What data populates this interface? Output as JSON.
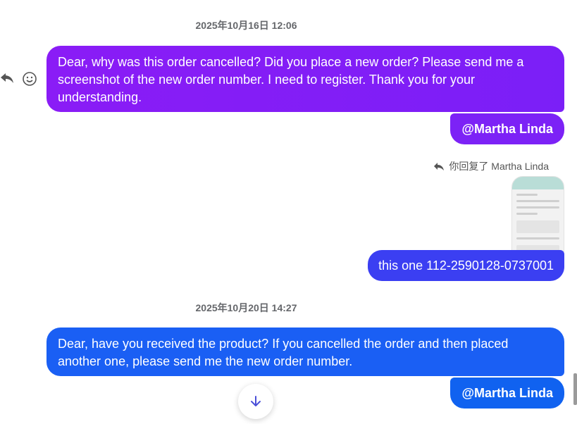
{
  "conversation": {
    "timestamp_1": "2025年10月16日 12:06",
    "message_1": "Dear, why was this order cancelled? Did you place a new order? Please send me a screenshot of the new order number. I need to register. Thank you for your understanding.",
    "mention_1": "@Martha Linda",
    "reply_label": "你回复了 Martha Linda",
    "reply_message": "this one 112-2590128-0737001",
    "timestamp_2": "2025年10月20日 14:27",
    "message_2": "Dear, have you received the product? If you cancelled the order and then placed another one, please send me the new order number.",
    "mention_2": "@Martha Linda"
  },
  "icons": {
    "reply": "reply-icon",
    "emoji": "smile-icon",
    "scroll": "arrow-down-icon"
  },
  "colors": {
    "purple_bubble": "#8a1cf6",
    "blue_bubble": "#3b3ff2",
    "bright_blue_bubble": "#1a5ff4"
  }
}
